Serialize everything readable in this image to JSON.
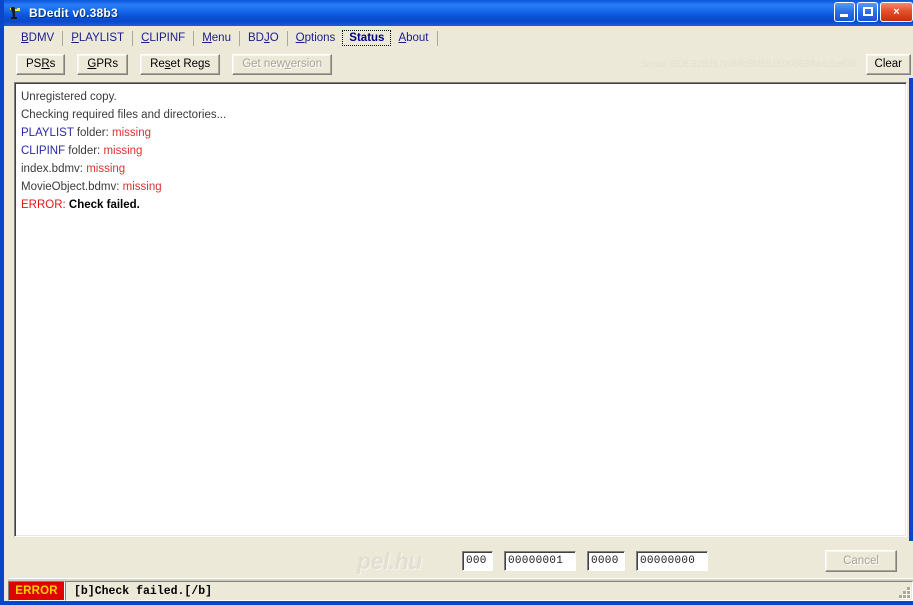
{
  "window": {
    "title": "BDedit v0.38b3",
    "icon": "app-bird-icon",
    "controls": {
      "minimize": "minimize",
      "maximize": "maximize",
      "close": "×"
    }
  },
  "menubar": {
    "items": [
      {
        "label": "BDMV",
        "accel": "B",
        "active": false
      },
      {
        "label": "PLAYLIST",
        "accel": "P",
        "active": false
      },
      {
        "label": "CLIPINF",
        "accel": "C",
        "active": false
      },
      {
        "label": "Menu",
        "accel": "M",
        "active": false
      },
      {
        "label": "BDJO",
        "accel": "J",
        "active": false
      },
      {
        "label": "Options",
        "accel": "O",
        "active": false
      },
      {
        "label": "Status",
        "accel": "",
        "active": true
      },
      {
        "label": "About",
        "accel": "A",
        "active": false
      }
    ]
  },
  "toolbar": {
    "buttons": [
      {
        "label": "PSRs",
        "accel": "R",
        "disabled": false
      },
      {
        "label": "GPRs",
        "accel": "G",
        "disabled": false
      },
      {
        "label": "Reset Regs",
        "accel": "s",
        "disabled": false
      },
      {
        "label": "Get new version",
        "accel": "v",
        "disabled": true
      }
    ],
    "serial": "Serial: BDE328d57c4bfc5fd5515905638a4cbef0d",
    "clear_label": "Clear"
  },
  "status_log": {
    "lines": [
      {
        "segments": [
          {
            "text": "Unregistered copy.",
            "style": "plain"
          }
        ]
      },
      {
        "segments": [
          {
            "text": "Checking required files and directories...",
            "style": "plain"
          }
        ]
      },
      {
        "segments": [
          {
            "text": "PLAYLIST",
            "style": "blue"
          },
          {
            "text": " folder: ",
            "style": "plain"
          },
          {
            "text": "missing",
            "style": "red"
          }
        ]
      },
      {
        "segments": [
          {
            "text": "CLIPINF",
            "style": "blue"
          },
          {
            "text": " folder:  ",
            "style": "plain"
          },
          {
            "text": "missing",
            "style": "red"
          }
        ]
      },
      {
        "segments": [
          {
            "text": "index.bdmv: ",
            "style": "plain"
          },
          {
            "text": "missing",
            "style": "red"
          }
        ]
      },
      {
        "segments": [
          {
            "text": "MovieObject.bdmv: ",
            "style": "plain"
          },
          {
            "text": "missing",
            "style": "red"
          }
        ]
      },
      {
        "segments": [
          {
            "text": "ERROR: ",
            "style": "err"
          },
          {
            "text": "Check failed.",
            "style": "bold"
          }
        ]
      }
    ]
  },
  "bottombar": {
    "watermark": "pel.hu",
    "fields": [
      {
        "name": "field-3digit",
        "value": "000"
      },
      {
        "name": "field-8digit-a",
        "value": "00000001"
      },
      {
        "name": "field-4digit",
        "value": "0000"
      },
      {
        "name": "field-8digit-b",
        "value": "00000000"
      }
    ],
    "cancel_label": "Cancel"
  },
  "statusbar": {
    "error_label": "ERROR",
    "message": "[b]Check failed.[/b]"
  },
  "colors": {
    "titlebar_blue": "#0b53d8",
    "window_border": "#0a46c8",
    "face": "#ece9d8",
    "menu_text": "#1c1c8c",
    "error_red": "#e00000",
    "error_text": "#ffd000",
    "log_red": "#e03030",
    "log_blue": "#2929a8"
  }
}
